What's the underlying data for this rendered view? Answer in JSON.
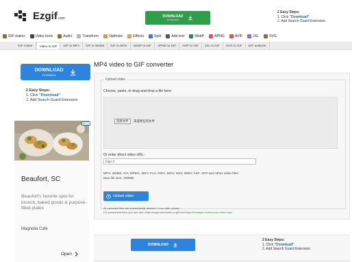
{
  "header": {
    "logo_text": "Ezgif",
    "logo_suffix": ".com",
    "download_label": "DOWNLOAD",
    "download_sub": "EXTENSION",
    "easy_steps_title": "2 Easy Steps:",
    "easy_steps_1_prefix": "1. Click ",
    "easy_steps_1_link": "\"Download\"",
    "easy_steps_2": "2. Add Search Guard Extension",
    "accent_color": "#2f9e4a"
  },
  "toolmenu": [
    {
      "label": "GIF maker",
      "icon": "gif-maker-icon",
      "color": "#8a6d3b"
    },
    {
      "label": "Video tools",
      "icon": "video-tools-icon",
      "color": "#444444"
    },
    {
      "label": "Audio",
      "icon": "audio-icon",
      "color": "#7a7a2a"
    },
    {
      "label": "Transform",
      "icon": "transform-icon",
      "color": "#b5b5b5"
    },
    {
      "label": "Optimize",
      "icon": "optimize-icon",
      "color": "#c8a23a"
    },
    {
      "label": "Effects",
      "icon": "effects-icon",
      "color": "#d9a73a"
    },
    {
      "label": "Split",
      "icon": "split-icon",
      "color": "#3a7ad9"
    },
    {
      "label": "Add text",
      "icon": "add-text-icon",
      "color": "#555555"
    },
    {
      "label": "WebP",
      "icon": "webp-icon",
      "color": "#2b8a3e"
    },
    {
      "label": "APNG",
      "icon": "apng-icon",
      "color": "#d9534f"
    },
    {
      "label": "AVIF",
      "icon": "avif-icon",
      "color": "#d9534f"
    },
    {
      "label": "JXL",
      "icon": "jxl-icon",
      "color": "#8e6ad9"
    },
    {
      "label": "SVG",
      "icon": "svg-icon",
      "color": "#8a6d3b"
    }
  ],
  "subtabs": [
    {
      "label": "GIF maker",
      "active": false
    },
    {
      "label": "Video to GIF",
      "active": true
    },
    {
      "label": "GIF to MP4",
      "active": false
    },
    {
      "label": "GIF to WebM",
      "active": false
    },
    {
      "label": "GIF to MOV",
      "active": false
    },
    {
      "label": "WebP to GIF",
      "active": false
    },
    {
      "label": "APNG to GIF",
      "active": false
    },
    {
      "label": "AVIF to GIF",
      "active": false
    },
    {
      "label": "JXL to GIF",
      "active": false
    },
    {
      "label": "SVG to GIF",
      "active": false
    },
    {
      "label": "GIF analyzer",
      "active": false
    }
  ],
  "sidebar": {
    "download_label": "DOWNLOAD",
    "download_sub": "EXTENSION",
    "easy_steps_title": "2 Easy Steps:",
    "easy_steps_1_prefix": "1. Click ",
    "easy_steps_1_link": "\"Download\"",
    "easy_steps_2": "2. Add Search Guard Extension",
    "ad": {
      "badge": "D▷ X",
      "title": "Beaufort, SC",
      "description": "Beaufort's favorite spot for brunch, baked goods & purpose-filled plates",
      "advertiser": "Magnolia Cafe",
      "cta": "Open"
    }
  },
  "main": {
    "title": "MP4 video to GIF converter",
    "legend": "Upload video",
    "choose_label": "Choose, paste, or drag and drop a file here:",
    "choose_button": "选择文件",
    "no_file": "未选择任何文件",
    "url_label": "Or enter direct video URL:",
    "url_value": "https://",
    "formats": "MP4, WebM, AVI, MPEG, MKV, FLV, OGG, MOV, M4V, WMV, ASF, 3GP and other video files",
    "max_size": "Max file size: 200MB",
    "upload_button": "Upload video",
    "note_1": "All uploaded files are automatically deleted 1 hour after upload.",
    "note_2_prefix": "For permanent links you can use: https://ezgif.com/video-to-gif?url=",
    "note_2_link": "https://example.com/source-video.mp4"
  },
  "bottom": {
    "download_label": "DOWNLOAD",
    "easy_steps_title": "2 Easy Steps:",
    "easy_steps_1_prefix": "1. Click ",
    "easy_steps_1_link": "\"Download\"",
    "easy_steps_2": "2. Add Search Guard Extension"
  }
}
